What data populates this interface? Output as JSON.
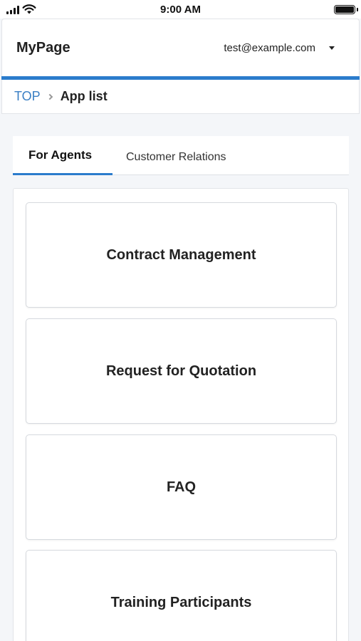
{
  "status_bar": {
    "time": "9:00 AM",
    "icons": [
      "signal-icon",
      "wifi-icon",
      "battery-icon"
    ]
  },
  "header": {
    "title": "MyPage",
    "user_email": "test@example.com",
    "accent_color": "#2b7ccc"
  },
  "breadcrumb": {
    "items": [
      {
        "label": "TOP"
      },
      {
        "label": "App list"
      }
    ]
  },
  "tabs": [
    {
      "label": "For Agents",
      "active": true
    },
    {
      "label": "Customer Relations",
      "active": false
    }
  ],
  "apps": [
    {
      "label": "Contract Management"
    },
    {
      "label": "Request for Quotation"
    },
    {
      "label": "FAQ"
    },
    {
      "label": "Training Participants"
    }
  ]
}
